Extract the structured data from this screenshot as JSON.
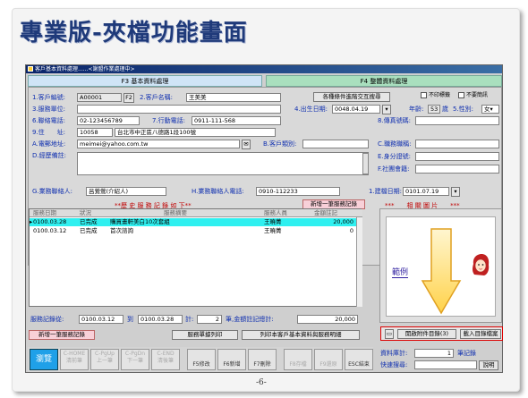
{
  "slide": {
    "title": "專業版-夾檔功能畫面",
    "page_number": "-6-"
  },
  "window": {
    "title": "客戶基本資料處理......<謝盟作業處理中>"
  },
  "tabs": {
    "f3": "F3 基本資料處理",
    "f4": "F4 整體資料處理"
  },
  "form": {
    "customer_no_label": "1.客戶編號:",
    "customer_no": "A00001",
    "f2_button": "F2",
    "customer_name_label": "2.客戶名稱:",
    "customer_name": "王美美",
    "query_button": "各種條件進階交互搜尋",
    "no_print_label": "不印標籤",
    "no_msg_label": "不要簡訊",
    "service_unit_label": "3.服務單位:",
    "birthday_label": "4.出生日期:",
    "birthday": "0048.04.19",
    "age_label": "年齡:",
    "age": "53",
    "age_unit": "歲",
    "gender_label": "5.性別:",
    "gender": "女",
    "phone_label": "6.聯絡電話:",
    "phone": "02-123456789",
    "mobile_label": "7.行動電話:",
    "mobile": "0911-111-568",
    "fax_label": "8.傳真號碼:",
    "address_label": "9.住　　址:",
    "zip": "10058",
    "address": "台北市中正區八德路1段100號",
    "email_label": "A.電郵地址:",
    "email": "meimei@yahoo.com.tw",
    "category_label": "B.客戶類別:",
    "job_label": "C.職務職稱:",
    "notes_label": "D.經歷備註:",
    "id_label": "E.身分證號:",
    "club_label": "F.社團會籍:",
    "contact_label": "G.業務聯絡人:",
    "contact": "呂鶯鶯(介紹人)",
    "contact_phone_label": "H.業務聯絡人電話:",
    "contact_phone": "0910-112233",
    "created_label": "1.建檔日期:",
    "created": "0101.07.19",
    "new_service_top": "新增一筆服務記錄"
  },
  "history": {
    "title": "**歷 史 服 務 記 錄 如 下**",
    "photo_title": "***　　相 關 圖 片　　***",
    "headers": [
      "服務日期",
      "狀況",
      "服務摘要",
      "服務人員",
      "金額註記"
    ],
    "rows": [
      {
        "date": "0100.03.28",
        "status": "已完成",
        "summary": "購買畫軒美白10次套組",
        "staff": "王曉菁",
        "amount": "20,000"
      },
      {
        "date": "0100.03.12",
        "status": "已完成",
        "summary": "首次諮詢",
        "staff": "王曉菁",
        "amount": "0"
      }
    ]
  },
  "summary": {
    "range_label": "服務記錄從:",
    "from": "0100.03.12",
    "to_label": "到",
    "to": "0100.03.28",
    "count_label": "計:",
    "count": "2",
    "count_unit": "筆,金額註記總計:",
    "total": "20,000"
  },
  "bottom_buttons": {
    "new_service": "新增一筆服務記錄",
    "print_list": "服務單據列印",
    "print_all": "列印本客戶基本資料與服務明細"
  },
  "attachments": {
    "open_label": "開啟附件目錄(3)",
    "import_label": "載入目錄檔案"
  },
  "sample_image": {
    "label": "範例"
  },
  "toolbar": {
    "browse": "瀏覽",
    "items": [
      "C-HOME\n清前筆",
      "C-PgUp\n上一筆",
      "C-PgDn\n下一筆",
      "C-END\n清後筆",
      "F5修改",
      "F6新增",
      "F7刪除",
      "F8存檔",
      "F9還原",
      "ESC結束"
    ]
  },
  "record_info": {
    "count_label": "資料庫計:",
    "count": "1",
    "count_unit": "筆記錄",
    "quick_label": "快速搜尋:",
    "help_button": "說明"
  }
}
